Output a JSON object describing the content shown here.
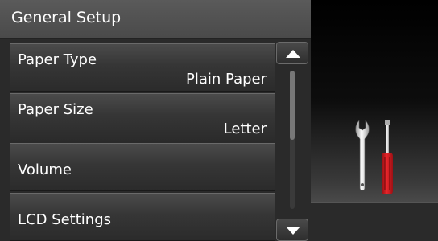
{
  "header": {
    "title": "General Setup"
  },
  "menu": {
    "items": [
      {
        "label": "Paper Type",
        "value": "Plain Paper"
      },
      {
        "label": "Paper Size",
        "value": "Letter"
      },
      {
        "label": "Volume",
        "value": ""
      },
      {
        "label": "LCD Settings",
        "value": ""
      }
    ]
  },
  "scrollbar": {
    "position": 0.0,
    "visible_fraction": 0.5
  },
  "icons": {
    "scroll_up": "triangle-up-icon",
    "scroll_down": "triangle-down-icon",
    "settings": "wrench-screwdriver-icon"
  },
  "colors": {
    "background": "#000000",
    "panel": "#2a2a2a",
    "header": "#4f4f4f",
    "text": "#ffffff",
    "screwdriver_handle": "#d0161b"
  }
}
